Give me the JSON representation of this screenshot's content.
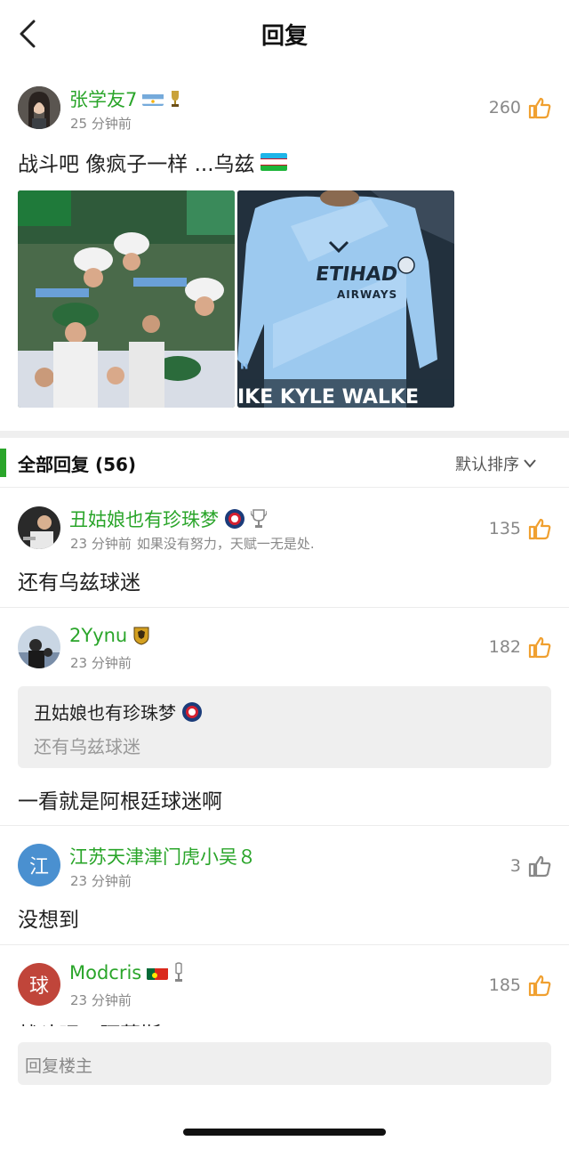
{
  "header": {
    "title": "回复"
  },
  "post": {
    "username": "张学友7",
    "time": "25 分钟前",
    "likes": "260",
    "content": "战斗吧 像疯子一样 ...乌兹",
    "image2_caption": "IKE KYLE WALKE",
    "image2_brand": "ETIHAD",
    "image2_brand_sub": "AIRWAYS"
  },
  "section": {
    "title": "全部回复 (56)",
    "sort_label": "默认排序"
  },
  "replies": [
    {
      "username": "丑姑娘也有珍珠梦",
      "time": "23 分钟前",
      "signature": "如果没有努力，天赋一无是处.",
      "likes": "135",
      "content": "还有乌兹球迷"
    },
    {
      "username": "2Yynu",
      "time": "23 分钟前",
      "likes": "182",
      "quote_name": "丑姑娘也有珍珠梦",
      "quote_text": "还有乌兹球迷",
      "content": "一看就是阿根廷球迷啊"
    },
    {
      "username": "江苏天津津门虎小吴８",
      "avatar_char": "江",
      "time": "23 分钟前",
      "likes": "3",
      "content": "没想到"
    },
    {
      "username": "Modcris",
      "avatar_char": "球",
      "time": "23 分钟前",
      "likes": "185",
      "content": "战斗吧，阿莫斯!"
    }
  ],
  "reply_bar": {
    "placeholder": "回复楼主"
  },
  "colors": {
    "accent_green": "#2aa52a",
    "like_orange": "#f0a030",
    "avatar_blue": "#4a90d0",
    "avatar_red": "#c0453a"
  }
}
